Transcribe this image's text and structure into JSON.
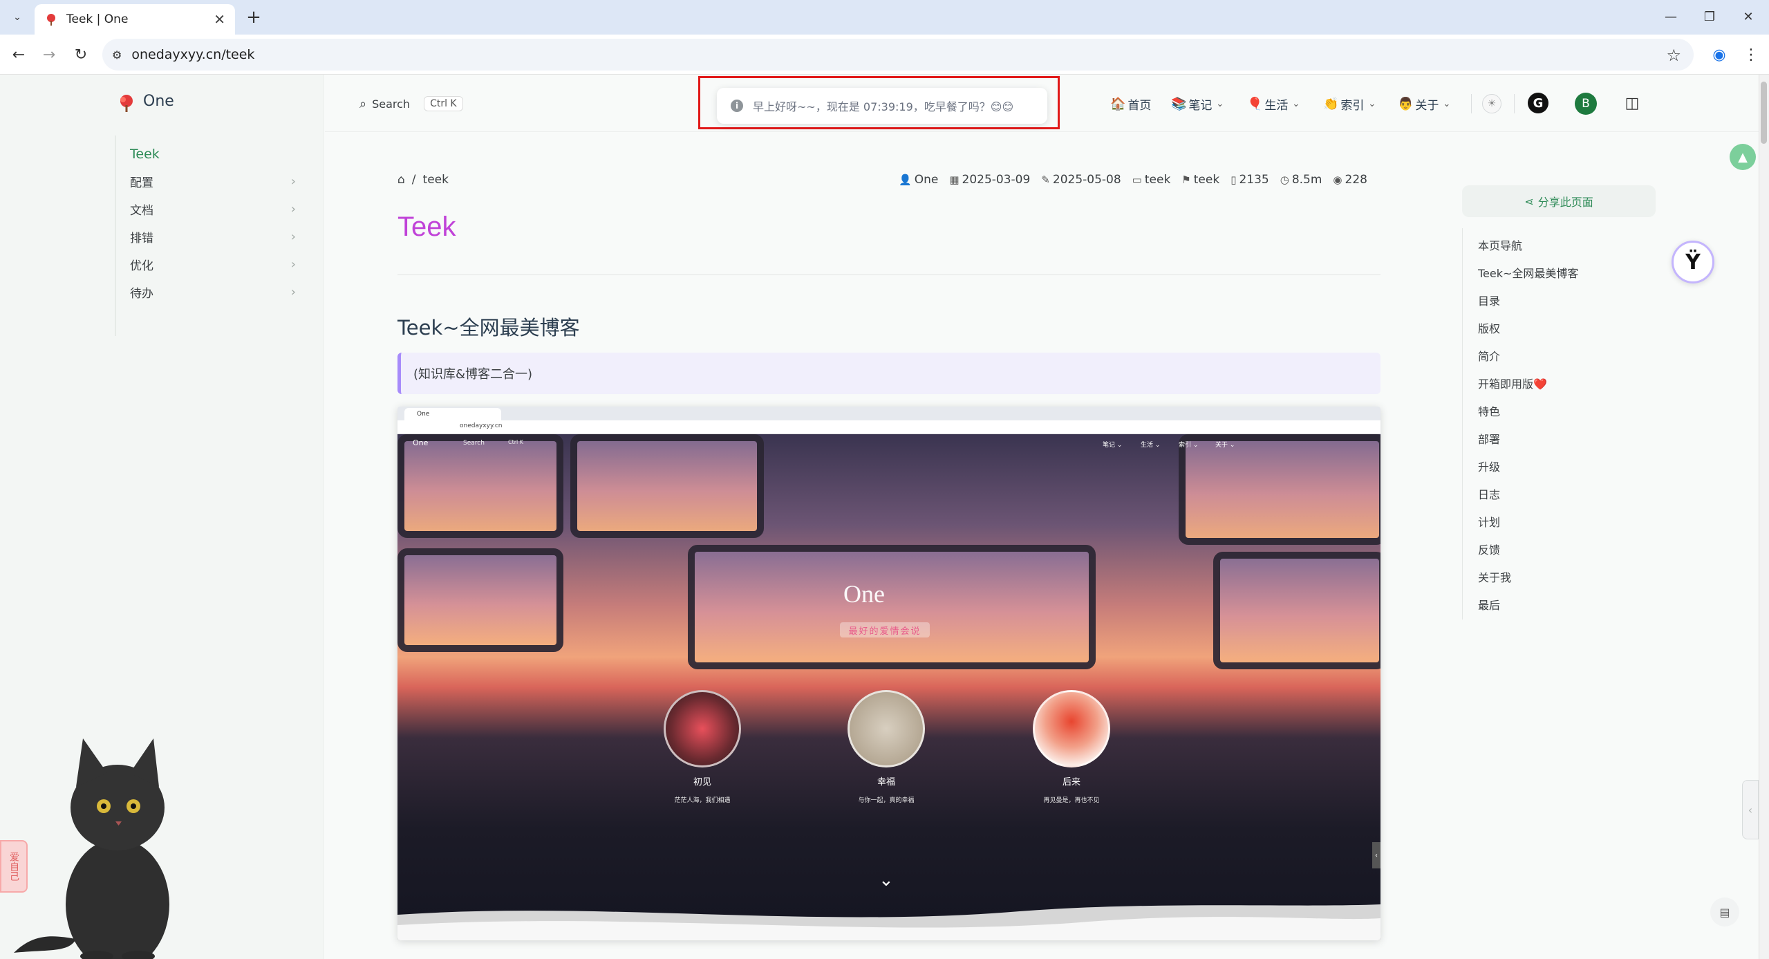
{
  "browser": {
    "tab_title": "Teek | One",
    "tab_close": "✕",
    "new_tab": "+",
    "url": "onedayxyy.cn/teek",
    "window_controls": {
      "minimize": "—",
      "restore": "❐",
      "close": "✕"
    },
    "nav": {
      "back": "←",
      "forward": "→",
      "reload": "↻"
    },
    "icons": [
      "tab-list-icon",
      "site-info-icon",
      "star-icon",
      "profile-icon",
      "menu-icon"
    ]
  },
  "sidebar": {
    "site_name": "One",
    "items": [
      {
        "label": "Teek",
        "active": true
      },
      {
        "label": "配置",
        "chevron": "›"
      },
      {
        "label": "文档",
        "chevron": "›"
      },
      {
        "label": "排错",
        "chevron": "›"
      },
      {
        "label": "优化",
        "chevron": "›"
      },
      {
        "label": "待办",
        "chevron": "›"
      }
    ]
  },
  "topnav": {
    "search_label": "Search",
    "search_kbd": "Ctrl K",
    "greeting": "早上好呀~~，现在是 07:39:19，吃早餐了吗？😊😊",
    "items": [
      {
        "emoji": "🏠",
        "label": "首页"
      },
      {
        "emoji": "📚",
        "label": "笔记",
        "dd": "⌄"
      },
      {
        "emoji": "🎈",
        "label": "生活",
        "dd": "⌄"
      },
      {
        "emoji": "👏",
        "label": "索引",
        "dd": "⌄"
      },
      {
        "emoji": "👨",
        "label": "关于",
        "dd": "⌄"
      }
    ],
    "avatar_letter": "B",
    "grammarly_letter": "G"
  },
  "article": {
    "breadcrumb": {
      "home_icon": "⌂",
      "sep": "/",
      "current": "teek"
    },
    "meta": {
      "author": "One",
      "created": "2025-03-09",
      "updated": "2025-05-08",
      "category": "teek",
      "tag": "teek",
      "words": "2135",
      "read_time": "8.5m",
      "views": "228"
    },
    "title": "Teek",
    "h2": "Teek~全网最美博客",
    "quote": "(知识库&博客二合一)"
  },
  "embedded_shot": {
    "tab": "One",
    "url": "onedayxyy.cn",
    "brand": "One",
    "search": "Search",
    "kbd": "Ctrl K",
    "nav": [
      "笔记 ⌄",
      "生活 ⌄",
      "索引 ⌄",
      "关于 ⌄"
    ],
    "hero_title": "One",
    "hero_tagline": "最好的爱情会说",
    "cards": [
      {
        "title": "初见",
        "sub": "茫茫人海，我们相遇"
      },
      {
        "title": "幸福",
        "sub": "与你一起，真的幸福"
      },
      {
        "title": "后来",
        "sub": "再见曼是，再也不见"
      }
    ],
    "arrow": "⌄"
  },
  "toc": {
    "share": "分享此页面",
    "share_icon": "share-icon",
    "items": [
      "本页导航",
      "Teek~全网最美博客",
      "目录",
      "版权",
      "简介",
      "开箱即用版❤️",
      "特色",
      "部署",
      "升级",
      "日志",
      "计划",
      "反馈",
      "关于我",
      "最后"
    ]
  },
  "widgets": {
    "cat_tab": "爱自己",
    "right_edge_tab": "‹",
    "teek_logo": "Ϋ"
  },
  "colors": {
    "accent": "#2e8b57",
    "title": "#c042d8",
    "highlight_box": "#e11919",
    "quote_border": "#a78bfa"
  }
}
